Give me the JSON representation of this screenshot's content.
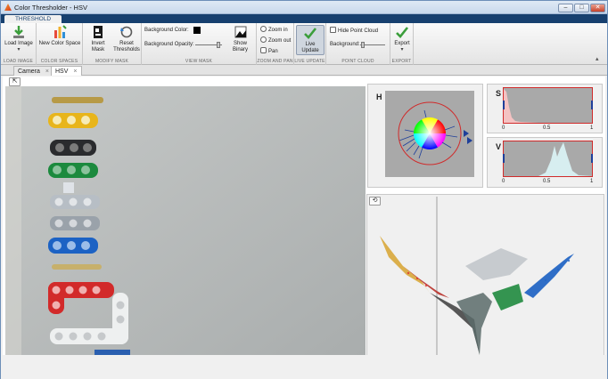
{
  "window": {
    "title": "Color Thresholder - HSV",
    "minimize": "–",
    "maximize": "□",
    "close": "✕"
  },
  "tab": {
    "threshold_label": "THRESHOLD"
  },
  "ribbon": {
    "load_image": {
      "button": "Load Image",
      "group": "LOAD IMAGE"
    },
    "color_spaces": {
      "button": "New Color Space",
      "group": "COLOR SPACES"
    },
    "modify_mask": {
      "invert": "Invert Mask",
      "reset": "Reset Thresholds",
      "group": "MODIFY MASK"
    },
    "view_mask": {
      "background_color_label": "Background Color:",
      "background_opacity_label": "Background Opacity:",
      "show_binary": "Show Binary",
      "group": "VIEW MASK"
    },
    "zoom_pan": {
      "zoom_in": "Zoom in",
      "zoom_out": "Zoom out",
      "pan": "Pan",
      "group": "ZOOM AND PAN"
    },
    "live_update": {
      "button": "Live Update",
      "group": "LIVE UPDATE"
    },
    "point_cloud": {
      "hide": "Hide Point Cloud",
      "background_label": "Background:",
      "group": "POINT CLOUD"
    },
    "export": {
      "button": "Export",
      "group": "EXPORT"
    }
  },
  "doc_tabs": [
    {
      "label": "Camera"
    },
    {
      "label": "HSV"
    }
  ],
  "channels": {
    "h": {
      "label": "H"
    },
    "s": {
      "label": "S",
      "ticks": [
        "0",
        "0.5",
        "1"
      ]
    },
    "v": {
      "label": "V",
      "ticks": [
        "0",
        "0.5",
        "1"
      ]
    }
  },
  "colors": {
    "title_bar": "#c9d9ec",
    "tab_strip": "#17406f",
    "histogram_bg": "#a9a9a9",
    "threshold_line": "#d02b2b",
    "handle": "#1e3f9a"
  },
  "icons": {
    "load": "down-arrow-icon",
    "color_space": "bar-chart-icon",
    "invert": "invert-icon",
    "reset": "reset-icon",
    "zoom_in": "zoom-in-icon",
    "zoom_out": "zoom-out-icon",
    "pan": "hand-icon",
    "live_update": "check-icon",
    "export": "check-icon"
  }
}
